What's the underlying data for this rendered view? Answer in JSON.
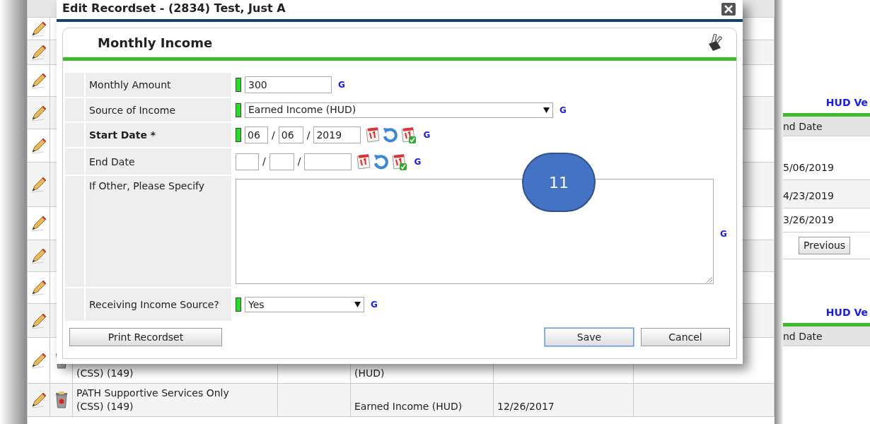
{
  "background_table": {
    "rows": [
      {},
      {},
      {},
      {},
      {},
      {},
      {},
      {},
      {},
      {},
      {
        "cells": [
          "(CSS) (149)",
          "",
          "(HUD)",
          "",
          ""
        ]
      },
      {
        "cells": [
          "PATH Supportive Services Only (CSS) (149)",
          "",
          "Earned Income (HUD)",
          "12/26/2017",
          ""
        ]
      }
    ]
  },
  "side_panel": {
    "sections": [
      {
        "title": "HUD Ve",
        "header": "nd Date",
        "rows": [
          "5/06/2019",
          "4/23/2019",
          "3/26/2019"
        ],
        "buttons": [
          "Previous"
        ]
      },
      {
        "title": "HUD Ve",
        "header": "nd Date"
      }
    ]
  },
  "dialog": {
    "title": "Edit Recordset - (2834) Test, Just A",
    "section_title": "Monthly Income",
    "fields": [
      {
        "kind": "text",
        "label": "Monthly Amount",
        "emphasized": false,
        "required": true,
        "value": "300",
        "help": "G"
      },
      {
        "kind": "select",
        "label": "Source of Income",
        "emphasized": false,
        "required": true,
        "value": "Earned Income (HUD)",
        "help": "G"
      },
      {
        "kind": "date",
        "label": "Start Date *",
        "emphasized": true,
        "required": true,
        "parts": [
          "06",
          "06",
          "2019"
        ],
        "separator": "/",
        "help": "G"
      },
      {
        "kind": "date",
        "label": "End Date",
        "emphasized": false,
        "required": false,
        "separator": "/",
        "help": "G"
      },
      {
        "kind": "textarea",
        "label": "If Other, Please Specify",
        "emphasized": false,
        "required": false,
        "help": "G"
      },
      {
        "kind": "select",
        "label": "Receiving Income Source?",
        "emphasized": false,
        "required": true,
        "value": "Yes",
        "help": "G"
      }
    ],
    "buttons": [
      {
        "label": "Print Recordset",
        "focused": false
      },
      {
        "label": "Save",
        "focused": true
      },
      {
        "label": "Cancel",
        "focused": false
      }
    ]
  },
  "annotation": {
    "label": "11"
  }
}
